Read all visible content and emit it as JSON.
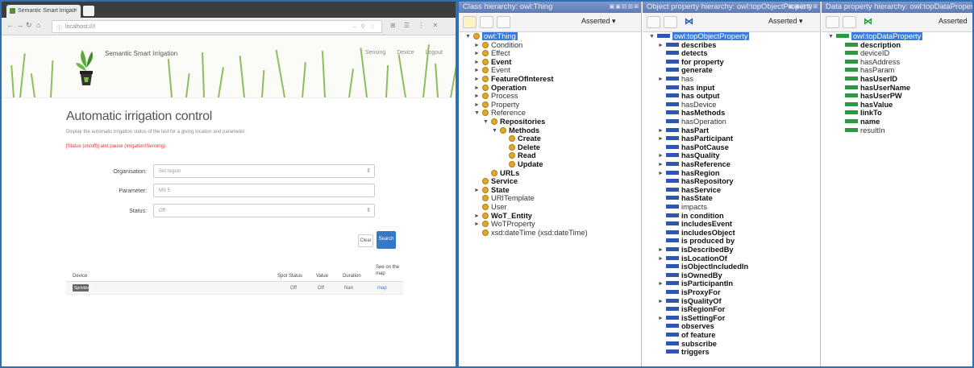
{
  "browser": {
    "tab_title": "Semantic Smart Irrigati",
    "tab_close": "×",
    "new_tab": "",
    "address": "localhost:////",
    "address_right": "– ⚲ ☆",
    "nav_back": "←",
    "nav_forward": "→",
    "nav_reload": "↻",
    "nav_home": "⌂",
    "nav_extras": "⊞ ☰ ⋮ ✕"
  },
  "site": {
    "name": "Semantic Smart Irrigation",
    "nav": [
      "Sensing",
      "Device",
      "Logout"
    ]
  },
  "page": {
    "title": "Automatic irrigation control",
    "description": "Display the automatic irrigation status of the last for a giving location and parameter.",
    "warning": "[Status (on/off)] and pause (Irrigation/Sensing)"
  },
  "form": {
    "organisation_label": "Organisation:",
    "organisation_value": "Set region",
    "parameter_label": "Parameter:",
    "parameter_value": "MS 5",
    "status_label": "Status:",
    "status_value": "Off",
    "clear_label": "Clear",
    "search_label": "Search"
  },
  "results": {
    "headers": [
      "Device",
      "Spot",
      "Status",
      "Value",
      "Duration",
      "See on the map"
    ],
    "rows": [
      {
        "device": "Sprinkler1",
        "spot": "",
        "status": "Off",
        "value": "Off",
        "duration": "Nan",
        "map": "map"
      }
    ]
  },
  "protege": {
    "class_panel": {
      "title": "Class hierarchy: owl:Thing",
      "asserted": "Asserted ▾",
      "nodes": [
        {
          "label": "owl:Thing",
          "selected": true,
          "bold": false
        },
        {
          "label": "Condition",
          "bold": false
        },
        {
          "label": "Effect",
          "bold": false
        },
        {
          "label": "Event",
          "bold": true
        },
        {
          "label": "Event",
          "bold": false
        },
        {
          "label": "FeatureOfInterest",
          "bold": true
        },
        {
          "label": "Operation",
          "bold": true
        },
        {
          "label": "Process",
          "bold": false
        },
        {
          "label": "Property",
          "bold": false
        },
        {
          "label": "Reference",
          "bold": false
        },
        {
          "label": "Repositories",
          "bold": true
        },
        {
          "label": "Methods",
          "bold": true
        },
        {
          "label": "Create",
          "bold": true
        },
        {
          "label": "Delete",
          "bold": true
        },
        {
          "label": "Read",
          "bold": true
        },
        {
          "label": "Update",
          "bold": true
        },
        {
          "label": "URLs",
          "bold": true
        },
        {
          "label": "Service",
          "bold": true
        },
        {
          "label": "State",
          "bold": true
        },
        {
          "label": "URITemplate",
          "bold": false
        },
        {
          "label": "User",
          "bold": false
        },
        {
          "label": "WoT_Entity",
          "bold": true
        },
        {
          "label": "WoTProperty",
          "bold": false
        },
        {
          "label": "xsd:dateTime (xsd:dateTime)",
          "bold": false
        }
      ]
    },
    "object_panel": {
      "title": "Object property hierarchy: owl:topObjectProperty",
      "asserted": "Asserted ▾",
      "nodes": [
        {
          "label": "owl:topObjectProperty",
          "selected": true,
          "bold": false
        },
        {
          "label": "describes",
          "bold": true
        },
        {
          "label": "detects",
          "bold": true
        },
        {
          "label": "for property",
          "bold": true
        },
        {
          "label": "generate",
          "bold": true
        },
        {
          "label": "has",
          "bold": false
        },
        {
          "label": "has input",
          "bold": true
        },
        {
          "label": "has output",
          "bold": true
        },
        {
          "label": "hasDevice",
          "bold": false
        },
        {
          "label": "hasMethods",
          "bold": true
        },
        {
          "label": "hasOperation",
          "bold": false
        },
        {
          "label": "hasPart",
          "bold": true
        },
        {
          "label": "hasParticipant",
          "bold": true
        },
        {
          "label": "hasPotCause",
          "bold": true
        },
        {
          "label": "hasQuality",
          "bold": true
        },
        {
          "label": "hasReference",
          "bold": true
        },
        {
          "label": "hasRegion",
          "bold": true
        },
        {
          "label": "hasRepository",
          "bold": true
        },
        {
          "label": "hasService",
          "bold": true
        },
        {
          "label": "hasState",
          "bold": true
        },
        {
          "label": "impacts",
          "bold": false
        },
        {
          "label": "in condition",
          "bold": true
        },
        {
          "label": "includesEvent",
          "bold": true
        },
        {
          "label": "includesObject",
          "bold": true
        },
        {
          "label": "is produced by",
          "bold": true
        },
        {
          "label": "isDescribedBy",
          "bold": true
        },
        {
          "label": "isLocationOf",
          "bold": true
        },
        {
          "label": "isObjectIncludedIn",
          "bold": true
        },
        {
          "label": "isOwnedBy",
          "bold": true
        },
        {
          "label": "isParticipantIn",
          "bold": true
        },
        {
          "label": "isProxyFor",
          "bold": true
        },
        {
          "label": "isQualityOf",
          "bold": true
        },
        {
          "label": "isRegionFor",
          "bold": true
        },
        {
          "label": "isSettingFor",
          "bold": true
        },
        {
          "label": "observes",
          "bold": true
        },
        {
          "label": "of feature",
          "bold": true
        },
        {
          "label": "subscribe",
          "bold": true
        },
        {
          "label": "triggers",
          "bold": true
        }
      ]
    },
    "data_panel": {
      "title": "Data property hierarchy: owl:topDataProperty",
      "asserted": "Asserted",
      "nodes": [
        {
          "label": "owl:topDataProperty",
          "selected": true,
          "bold": false
        },
        {
          "label": "description",
          "bold": true
        },
        {
          "label": "deviceID",
          "bold": false
        },
        {
          "label": "hasAddress",
          "bold": false
        },
        {
          "label": "hasParam",
          "bold": false
        },
        {
          "label": "hasUserID",
          "bold": true
        },
        {
          "label": "hasUserName",
          "bold": true
        },
        {
          "label": "hasUserPW",
          "bold": true
        },
        {
          "label": "hasValue",
          "bold": true
        },
        {
          "label": "linkTo",
          "bold": true
        },
        {
          "label": "name",
          "bold": true
        },
        {
          "label": "resultIn",
          "bold": false
        }
      ]
    },
    "header_buttons": "▣▣▤▤⊠"
  },
  "colors": {
    "accent_blue": "#2f6fb6",
    "panel_header": "#6f88c0",
    "class_dot": "#e0a92c",
    "object_bar": "#2f56b0",
    "data_bar": "#2b9a3e",
    "selection": "#3a7bd5"
  }
}
